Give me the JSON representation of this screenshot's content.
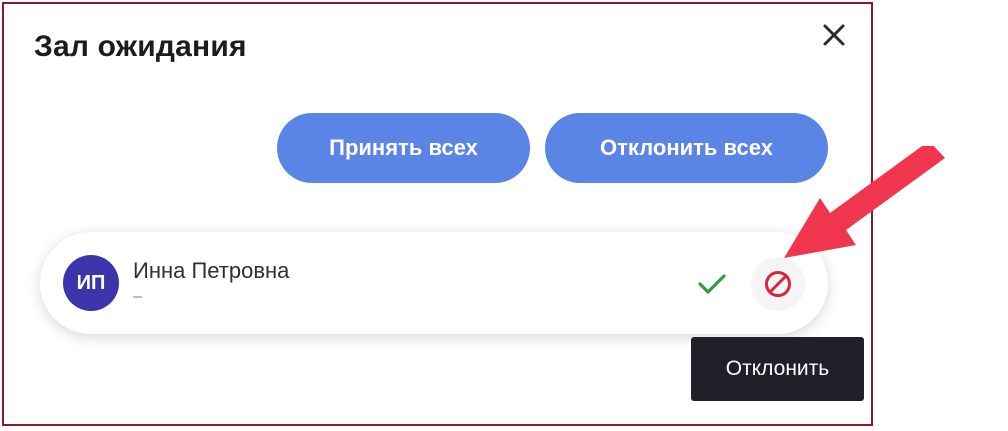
{
  "dialog": {
    "title": "Зал ожидания",
    "close_icon": "close-icon"
  },
  "actions": {
    "accept_all_label": "Принять всех",
    "reject_all_label": "Отклонить всех"
  },
  "participant": {
    "initials": "ИП",
    "name": "Инна Петровна",
    "subtitle": "–",
    "accept_icon": "check-icon",
    "reject_icon": "ban-icon"
  },
  "tooltip": {
    "label": "Отклонить"
  },
  "colors": {
    "primary_button": "#5a84e6",
    "avatar": "#3c34ab",
    "accept": "#2ea043",
    "reject": "#d7263d",
    "annotation_arrow": "#f0364f",
    "frame_border": "#8b1a24",
    "tooltip_bg": "#1f2029"
  }
}
